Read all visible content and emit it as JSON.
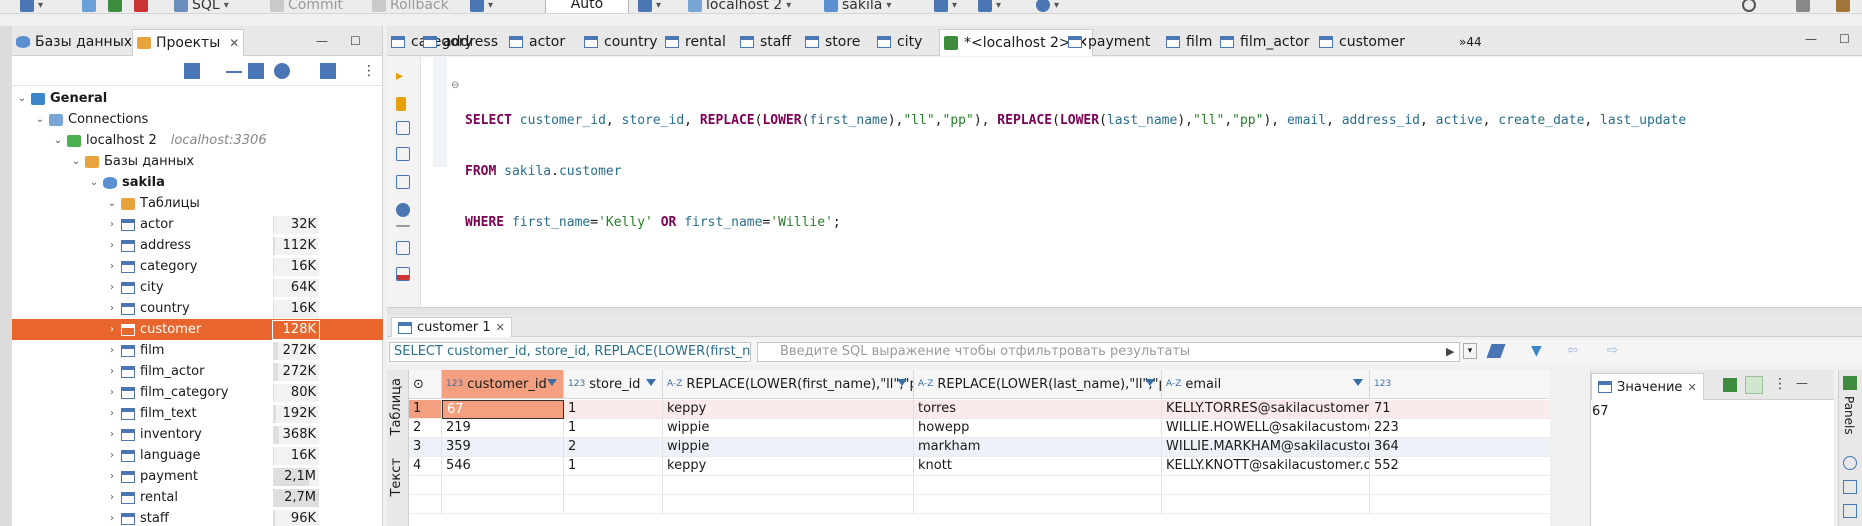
{
  "toolbar": {
    "sql_label": "SQL",
    "commit_label": "Commit",
    "rollback_label": "Rollback",
    "transaction_mode": "Auto",
    "connection": "localhost 2",
    "database": "sakila"
  },
  "left_panel": {
    "tab_databases": "Базы данных",
    "tab_projects": "Проекты",
    "tree": {
      "general": "General",
      "connections": "Connections",
      "host": "localhost 2",
      "host_address": "localhost:3306",
      "databases": "Базы данных",
      "schema": "sakila",
      "tables_folder": "Таблицы"
    },
    "tables": [
      {
        "name": "actor",
        "size": "32K",
        "fill": 0.02
      },
      {
        "name": "address",
        "size": "112K",
        "fill": 0.04
      },
      {
        "name": "category",
        "size": "16K",
        "fill": 0.01
      },
      {
        "name": "city",
        "size": "64K",
        "fill": 0.02
      },
      {
        "name": "country",
        "size": "16K",
        "fill": 0.01
      },
      {
        "name": "customer",
        "size": "128K",
        "fill": 0.05,
        "selected": true
      },
      {
        "name": "film",
        "size": "272K",
        "fill": 0.1
      },
      {
        "name": "film_actor",
        "size": "272K",
        "fill": 0.1
      },
      {
        "name": "film_category",
        "size": "80K",
        "fill": 0.03
      },
      {
        "name": "film_text",
        "size": "192K",
        "fill": 0.07
      },
      {
        "name": "inventory",
        "size": "368K",
        "fill": 0.13
      },
      {
        "name": "language",
        "size": "16K",
        "fill": 0.01
      },
      {
        "name": "payment",
        "size": "2,1M",
        "fill": 0.78
      },
      {
        "name": "rental",
        "size": "2,7M",
        "fill": 1.0
      },
      {
        "name": "staff",
        "size": "96K",
        "fill": 0.04
      }
    ]
  },
  "editor_tabs": [
    {
      "label": "category",
      "type": "table"
    },
    {
      "label": "address",
      "type": "table"
    },
    {
      "label": "actor",
      "type": "table"
    },
    {
      "label": "country",
      "type": "table"
    },
    {
      "label": "rental",
      "type": "table"
    },
    {
      "label": "staff",
      "type": "table"
    },
    {
      "label": "store",
      "type": "table"
    },
    {
      "label": "city",
      "type": "table"
    },
    {
      "label": "*<localhost 2>",
      "type": "sql",
      "active": true
    },
    {
      "label": "payment",
      "type": "table"
    },
    {
      "label": "film",
      "type": "table"
    },
    {
      "label": "film_actor",
      "type": "table"
    },
    {
      "label": "customer",
      "type": "table"
    }
  ],
  "editor_tabs_overflow": "»44",
  "sql": {
    "line1": [
      [
        "kw",
        "SELECT"
      ],
      [
        "sym",
        " "
      ],
      [
        "ident",
        "customer_id"
      ],
      [
        "sym",
        ", "
      ],
      [
        "ident",
        "store_id"
      ],
      [
        "sym",
        ", "
      ],
      [
        "kw",
        "REPLACE"
      ],
      [
        "sym",
        "("
      ],
      [
        "kw",
        "LOWER"
      ],
      [
        "sym",
        "("
      ],
      [
        "ident",
        "first_name"
      ],
      [
        "sym",
        "),"
      ],
      [
        "str",
        "\"ll\""
      ],
      [
        "sym",
        ","
      ],
      [
        "str",
        "\"pp\""
      ],
      [
        "sym",
        "), "
      ],
      [
        "kw",
        "REPLACE"
      ],
      [
        "sym",
        "("
      ],
      [
        "kw",
        "LOWER"
      ],
      [
        "sym",
        "("
      ],
      [
        "ident",
        "last_name"
      ],
      [
        "sym",
        "),"
      ],
      [
        "str",
        "\"ll\""
      ],
      [
        "sym",
        ","
      ],
      [
        "str",
        "\"pp\""
      ],
      [
        "sym",
        "), "
      ],
      [
        "ident",
        "email"
      ],
      [
        "sym",
        ", "
      ],
      [
        "ident",
        "address_id"
      ],
      [
        "sym",
        ", "
      ],
      [
        "ident",
        "active"
      ],
      [
        "sym",
        ", "
      ],
      [
        "ident",
        "create_date"
      ],
      [
        "sym",
        ", "
      ],
      [
        "ident",
        "last_update"
      ]
    ],
    "line2": [
      [
        "kw",
        "FROM"
      ],
      [
        "sym",
        " "
      ],
      [
        "ident",
        "sakila"
      ],
      [
        "sym",
        "."
      ],
      [
        "ident",
        "customer"
      ]
    ],
    "line3": [
      [
        "kw",
        "WHERE"
      ],
      [
        "sym",
        " "
      ],
      [
        "ident",
        "first_name"
      ],
      [
        "sym",
        "="
      ],
      [
        "str",
        "'Kelly'"
      ],
      [
        "sym",
        " "
      ],
      [
        "kw",
        "OR"
      ],
      [
        "sym",
        " "
      ],
      [
        "ident",
        "first_name"
      ],
      [
        "sym",
        "="
      ],
      [
        "str",
        "'Willie'"
      ],
      [
        "sym",
        ";"
      ]
    ]
  },
  "results": {
    "tab_label": "customer 1",
    "query_preview": "SELECT customer_id, store_id, REPLACE(LOWER(first_na",
    "filter_placeholder": "Введите SQL выражение чтобы отфильтровать результаты",
    "side_tab_table": "Таблица",
    "side_tab_text": "Текст",
    "columns": [
      {
        "label": "customer_id",
        "type": "123"
      },
      {
        "label": "store_id",
        "type": "123"
      },
      {
        "label": "REPLACE(LOWER(first_name),\"ll\",\"pp\")",
        "type": "A-Z"
      },
      {
        "label": "REPLACE(LOWER(last_name),\"ll\",\"pp\")",
        "type": "A-Z"
      },
      {
        "label": "email",
        "type": "A-Z"
      },
      {
        "label": "",
        "type": "123"
      }
    ],
    "rows": [
      {
        "num": "1",
        "cells": [
          "67",
          "1",
          "keppy",
          "torres",
          "KELLY.TORRES@sakilacustomer.org",
          "71"
        ]
      },
      {
        "num": "2",
        "cells": [
          "219",
          "1",
          "wippie",
          "howepp",
          "WILLIE.HOWELL@sakilacustomer.org",
          "223"
        ]
      },
      {
        "num": "3",
        "cells": [
          "359",
          "2",
          "wippie",
          "markham",
          "WILLIE.MARKHAM@sakilacustomer.org",
          "364"
        ]
      },
      {
        "num": "4",
        "cells": [
          "546",
          "1",
          "keppy",
          "knott",
          "KELLY.KNOTT@sakilacustomer.org",
          "552"
        ]
      }
    ]
  },
  "value_panel": {
    "title": "Значение",
    "value": "67",
    "panels_label": "Panels"
  }
}
